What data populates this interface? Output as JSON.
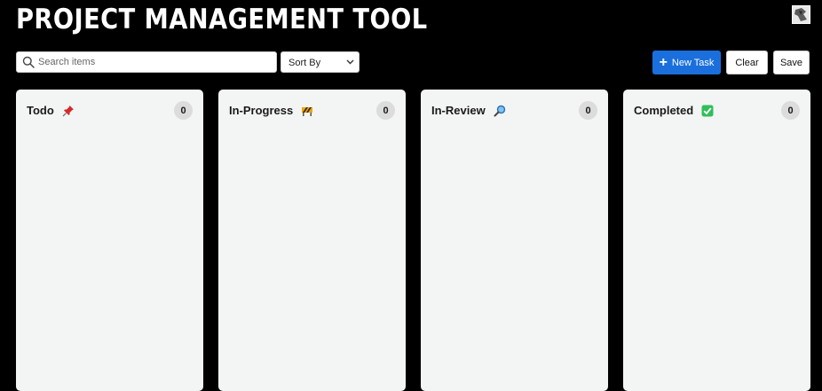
{
  "app": {
    "title": "PROJECT MANAGEMENT TOOL"
  },
  "toolbar": {
    "search_placeholder": "Search items",
    "sort_label": "Sort By",
    "new_task_label": "New Task",
    "clear_label": "Clear",
    "save_label": "Save"
  },
  "colors": {
    "accent": "#1a6fdc",
    "column_bg": "#f3f4f4",
    "background": "#000000"
  },
  "columns": [
    {
      "title": "Todo",
      "icon": "pushpin-icon",
      "count": "0"
    },
    {
      "title": "In-Progress",
      "icon": "construction-barrier-icon",
      "count": "0"
    },
    {
      "title": "In-Review",
      "icon": "magnifying-glass-icon",
      "count": "0"
    },
    {
      "title": "Completed",
      "icon": "check-mark-button-icon",
      "count": "0"
    }
  ]
}
